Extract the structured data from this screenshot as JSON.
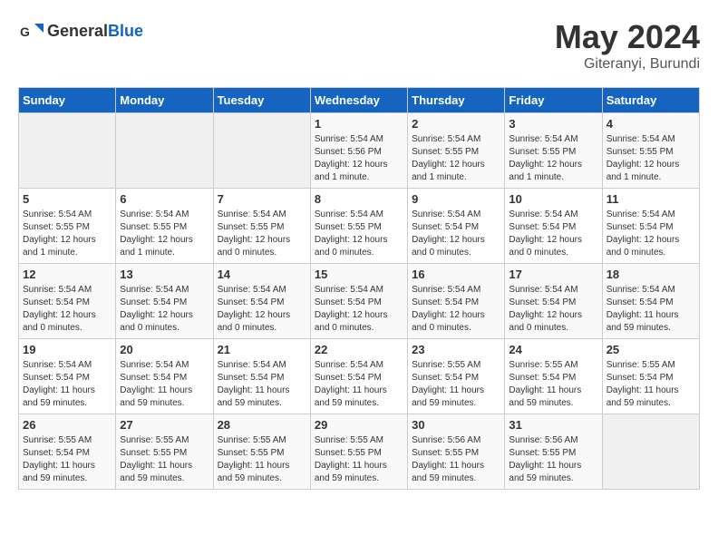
{
  "header": {
    "logo_general": "General",
    "logo_blue": "Blue",
    "month": "May 2024",
    "location": "Giteranyi, Burundi"
  },
  "weekdays": [
    "Sunday",
    "Monday",
    "Tuesday",
    "Wednesday",
    "Thursday",
    "Friday",
    "Saturday"
  ],
  "weeks": [
    [
      {
        "day": "",
        "info": ""
      },
      {
        "day": "",
        "info": ""
      },
      {
        "day": "",
        "info": ""
      },
      {
        "day": "1",
        "info": "Sunrise: 5:54 AM\nSunset: 5:56 PM\nDaylight: 12 hours\nand 1 minute."
      },
      {
        "day": "2",
        "info": "Sunrise: 5:54 AM\nSunset: 5:55 PM\nDaylight: 12 hours\nand 1 minute."
      },
      {
        "day": "3",
        "info": "Sunrise: 5:54 AM\nSunset: 5:55 PM\nDaylight: 12 hours\nand 1 minute."
      },
      {
        "day": "4",
        "info": "Sunrise: 5:54 AM\nSunset: 5:55 PM\nDaylight: 12 hours\nand 1 minute."
      }
    ],
    [
      {
        "day": "5",
        "info": "Sunrise: 5:54 AM\nSunset: 5:55 PM\nDaylight: 12 hours\nand 1 minute."
      },
      {
        "day": "6",
        "info": "Sunrise: 5:54 AM\nSunset: 5:55 PM\nDaylight: 12 hours\nand 1 minute."
      },
      {
        "day": "7",
        "info": "Sunrise: 5:54 AM\nSunset: 5:55 PM\nDaylight: 12 hours\nand 0 minutes."
      },
      {
        "day": "8",
        "info": "Sunrise: 5:54 AM\nSunset: 5:55 PM\nDaylight: 12 hours\nand 0 minutes."
      },
      {
        "day": "9",
        "info": "Sunrise: 5:54 AM\nSunset: 5:54 PM\nDaylight: 12 hours\nand 0 minutes."
      },
      {
        "day": "10",
        "info": "Sunrise: 5:54 AM\nSunset: 5:54 PM\nDaylight: 12 hours\nand 0 minutes."
      },
      {
        "day": "11",
        "info": "Sunrise: 5:54 AM\nSunset: 5:54 PM\nDaylight: 12 hours\nand 0 minutes."
      }
    ],
    [
      {
        "day": "12",
        "info": "Sunrise: 5:54 AM\nSunset: 5:54 PM\nDaylight: 12 hours\nand 0 minutes."
      },
      {
        "day": "13",
        "info": "Sunrise: 5:54 AM\nSunset: 5:54 PM\nDaylight: 12 hours\nand 0 minutes."
      },
      {
        "day": "14",
        "info": "Sunrise: 5:54 AM\nSunset: 5:54 PM\nDaylight: 12 hours\nand 0 minutes."
      },
      {
        "day": "15",
        "info": "Sunrise: 5:54 AM\nSunset: 5:54 PM\nDaylight: 12 hours\nand 0 minutes."
      },
      {
        "day": "16",
        "info": "Sunrise: 5:54 AM\nSunset: 5:54 PM\nDaylight: 12 hours\nand 0 minutes."
      },
      {
        "day": "17",
        "info": "Sunrise: 5:54 AM\nSunset: 5:54 PM\nDaylight: 12 hours\nand 0 minutes."
      },
      {
        "day": "18",
        "info": "Sunrise: 5:54 AM\nSunset: 5:54 PM\nDaylight: 11 hours\nand 59 minutes."
      }
    ],
    [
      {
        "day": "19",
        "info": "Sunrise: 5:54 AM\nSunset: 5:54 PM\nDaylight: 11 hours\nand 59 minutes."
      },
      {
        "day": "20",
        "info": "Sunrise: 5:54 AM\nSunset: 5:54 PM\nDaylight: 11 hours\nand 59 minutes."
      },
      {
        "day": "21",
        "info": "Sunrise: 5:54 AM\nSunset: 5:54 PM\nDaylight: 11 hours\nand 59 minutes."
      },
      {
        "day": "22",
        "info": "Sunrise: 5:54 AM\nSunset: 5:54 PM\nDaylight: 11 hours\nand 59 minutes."
      },
      {
        "day": "23",
        "info": "Sunrise: 5:55 AM\nSunset: 5:54 PM\nDaylight: 11 hours\nand 59 minutes."
      },
      {
        "day": "24",
        "info": "Sunrise: 5:55 AM\nSunset: 5:54 PM\nDaylight: 11 hours\nand 59 minutes."
      },
      {
        "day": "25",
        "info": "Sunrise: 5:55 AM\nSunset: 5:54 PM\nDaylight: 11 hours\nand 59 minutes."
      }
    ],
    [
      {
        "day": "26",
        "info": "Sunrise: 5:55 AM\nSunset: 5:54 PM\nDaylight: 11 hours\nand 59 minutes."
      },
      {
        "day": "27",
        "info": "Sunrise: 5:55 AM\nSunset: 5:55 PM\nDaylight: 11 hours\nand 59 minutes."
      },
      {
        "day": "28",
        "info": "Sunrise: 5:55 AM\nSunset: 5:55 PM\nDaylight: 11 hours\nand 59 minutes."
      },
      {
        "day": "29",
        "info": "Sunrise: 5:55 AM\nSunset: 5:55 PM\nDaylight: 11 hours\nand 59 minutes."
      },
      {
        "day": "30",
        "info": "Sunrise: 5:56 AM\nSunset: 5:55 PM\nDaylight: 11 hours\nand 59 minutes."
      },
      {
        "day": "31",
        "info": "Sunrise: 5:56 AM\nSunset: 5:55 PM\nDaylight: 11 hours\nand 59 minutes."
      },
      {
        "day": "",
        "info": ""
      }
    ]
  ]
}
